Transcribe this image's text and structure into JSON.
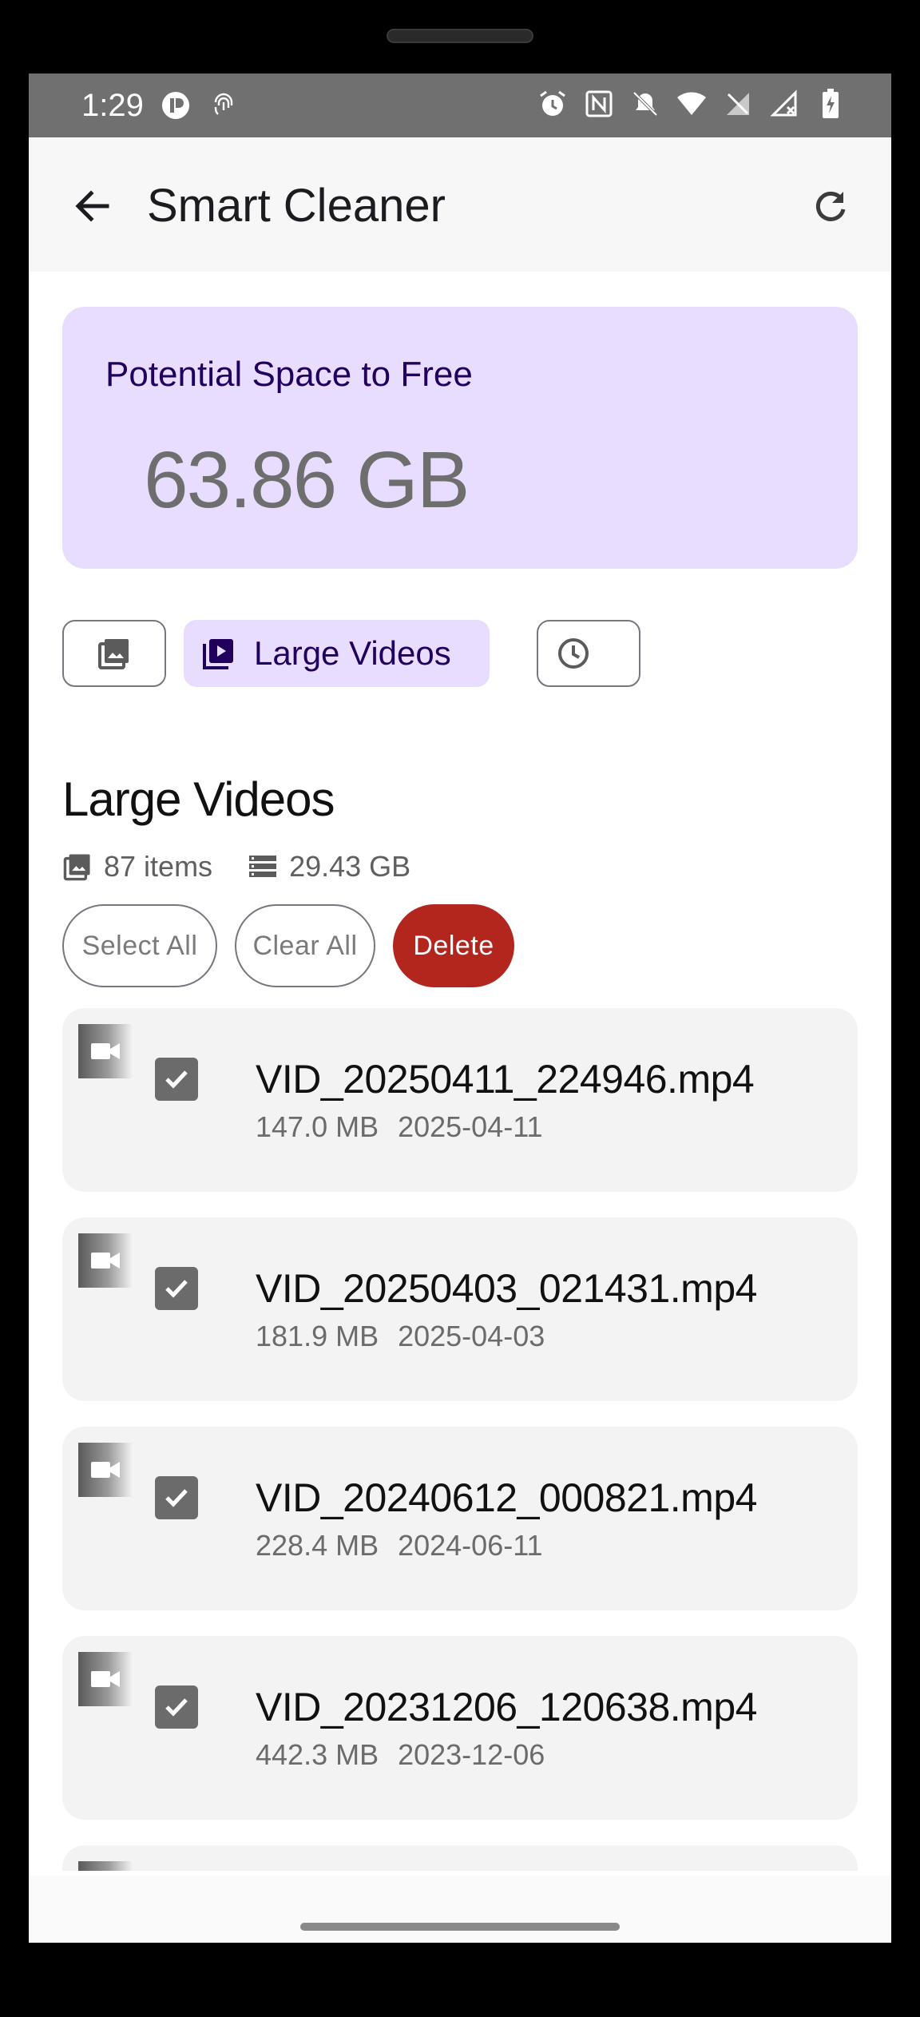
{
  "status_bar": {
    "time": "1:29",
    "left_icons": [
      "app-notification-icon",
      "fingerprint-icon"
    ],
    "right_icons": [
      "alarm-icon",
      "nfc-icon",
      "mute-icon",
      "wifi-icon",
      "no-sim-icon",
      "no-signal-icon",
      "battery-charging-icon"
    ]
  },
  "app_bar": {
    "title": "Smart Cleaner",
    "back_icon": "arrow-back-icon",
    "refresh_icon": "refresh-icon"
  },
  "summary": {
    "label": "Potential Space to Free",
    "value": "63.86 GB"
  },
  "filters": [
    {
      "icon": "image-icon",
      "label": "",
      "selected": false
    },
    {
      "icon": "video-library-icon",
      "label": "Large Videos",
      "selected": true
    },
    {
      "icon": "clock-icon",
      "label": "",
      "selected": false
    }
  ],
  "section": {
    "title": "Large Videos",
    "item_count": "87 items",
    "total_size": "29.43 GB"
  },
  "actions": {
    "select_all": "Select All",
    "clear_all": "Clear All",
    "delete": "Delete"
  },
  "files": [
    {
      "name": "VID_20250411_224946.mp4",
      "size": "147.0 MB",
      "date": "2025-04-11",
      "checked": true
    },
    {
      "name": "VID_20250403_021431.mp4",
      "size": "181.9 MB",
      "date": "2025-04-03",
      "checked": true
    },
    {
      "name": "VID_20240612_000821.mp4",
      "size": "228.4 MB",
      "date": "2024-06-11",
      "checked": true
    },
    {
      "name": "VID_20231206_120638.mp4",
      "size": "442.3 MB",
      "date": "2023-12-06",
      "checked": true
    }
  ],
  "colors": {
    "accent_container": "#e9ddff",
    "on_accent": "#21005d",
    "danger": "#b3261e",
    "status_bar": "#707070"
  }
}
